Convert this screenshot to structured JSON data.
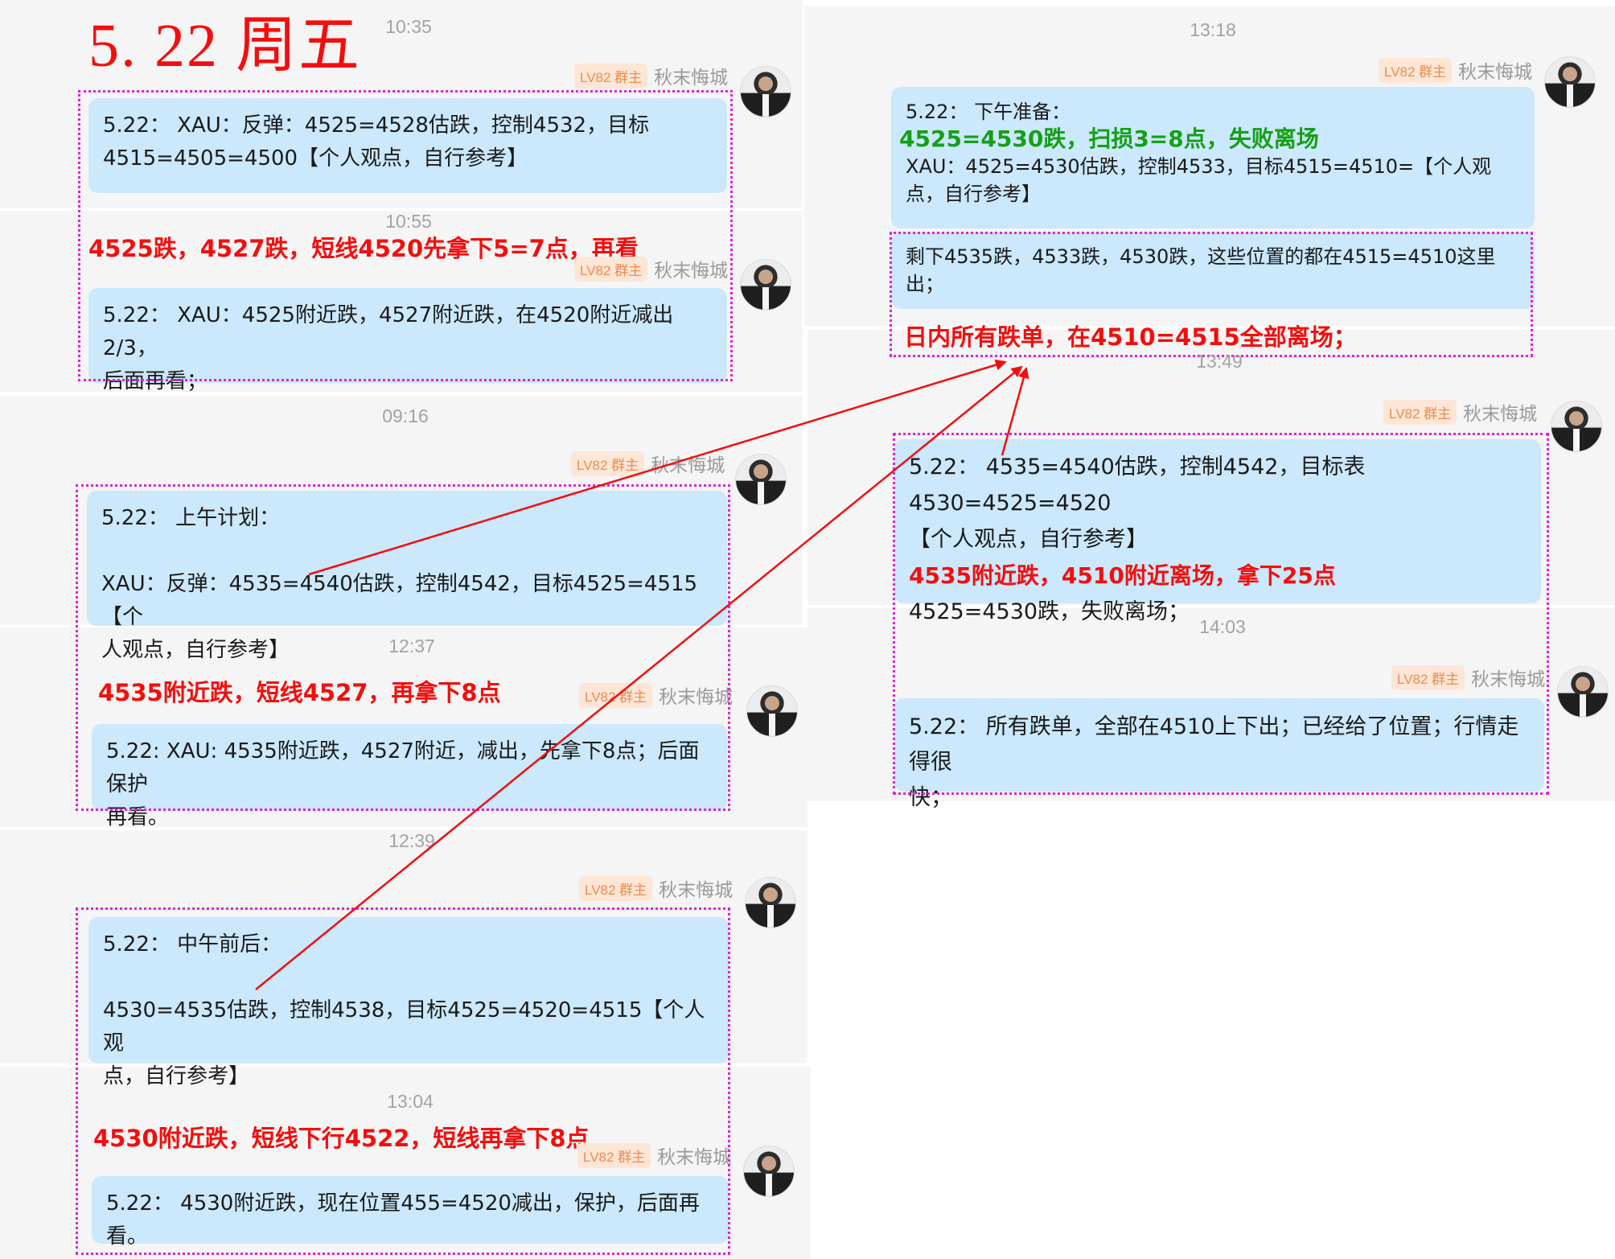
{
  "page": {
    "title": "5. 22 周五"
  },
  "sender": {
    "badge": "LV82 群主",
    "name": "秋末悔城"
  },
  "colors": {
    "accent_red": "#f50d0d",
    "bubble": "#cbe8fc",
    "highlight": "#e020e0",
    "green": "#15a015"
  },
  "left": {
    "m1": {
      "time": "10:35",
      "lines": [
        "5.22： XAU：反弹：4525=4528估跌，控制4532，目标",
        "4515=4505=4500【个人观点，自行参考】"
      ]
    },
    "m2": {
      "time": "10:55",
      "note": "4525跌，4527跌，短线4520先拿下5=7点，再看",
      "lines": [
        "5.22： XAU：4525附近跌，4527附近跌，在4520附近减出2/3，",
        "后面再看；"
      ]
    },
    "m3": {
      "time": "09:16",
      "lines": [
        "5.22： 上午计划：",
        "",
        "XAU：反弹：4535=4540估跌，控制4542，目标4525=4515【个",
        "人观点，自行参考】"
      ]
    },
    "m4": {
      "time": "12:37",
      "note": "4535附近跌，短线4527，再拿下8点",
      "lines": [
        "5.22: XAU: 4535附近跌，4527附近，减出，先拿下8点；后面保护",
        "再看。"
      ]
    },
    "m5": {
      "time": "12:39",
      "lines": [
        "5.22： 中午前后：",
        "",
        "4530=4535估跌，控制4538，目标4525=4520=4515【个人观",
        "点，自行参考】"
      ]
    },
    "m6": {
      "time": "13:04",
      "note": "4530附近跌，短线下行4522，短线再拿下8点",
      "lines": [
        "5.22： 4530附近跌，现在位置455=4520减出，保护，后面再看。"
      ]
    }
  },
  "right": {
    "m1": {
      "time": "13:18",
      "head": "5.22： 下午准备：",
      "green_note": "4525=4530跌，扫损3=8点，失败离场",
      "lines": [
        "XAU：4525=4530估跌，控制4533，目标4515=4510=【个人观",
        "点，自行参考】"
      ]
    },
    "m2": {
      "lines": [
        "剩下4535跌，4533跌，4530跌，这些位置的都在4515=4510这里",
        "出；"
      ],
      "note": "日内所有跌单，在4510=4515全部离场；"
    },
    "m3": {
      "time": "13:49",
      "lines": [
        "5.22： 4535=4540估跌，控制4542，目标表4530=4525=4520",
        "【个人观点，自行参考】"
      ],
      "note": "4535附近跌，4510附近离场，拿下25点",
      "tail": "4525=4530跌，失败离场；"
    },
    "m4": {
      "time": "14:03",
      "lines": [
        "5.22： 所有跌单，全部在4510上下出；已经给了位置；行情走得很",
        "快；"
      ]
    }
  }
}
